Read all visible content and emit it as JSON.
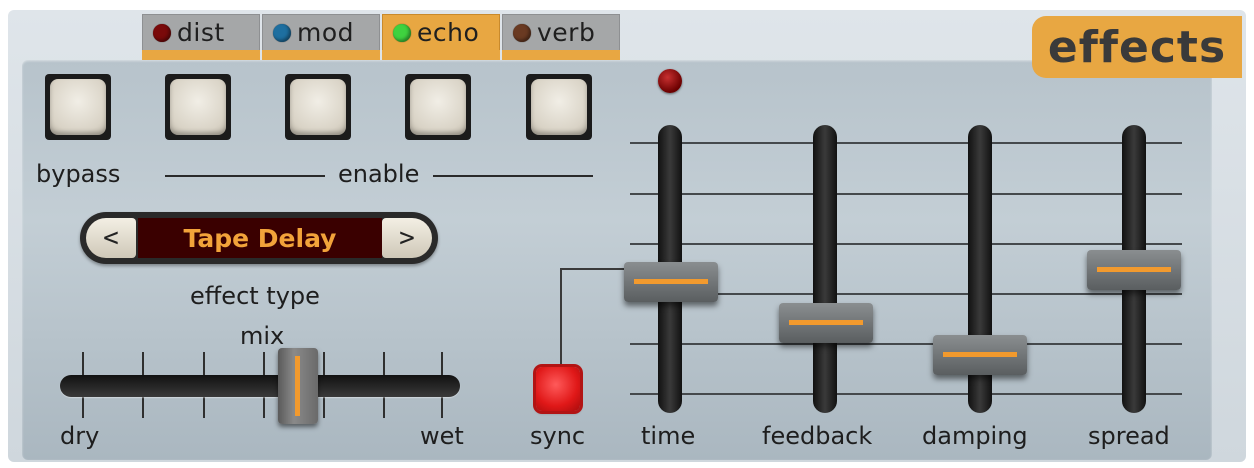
{
  "tabs": [
    {
      "label": "dist",
      "lamp_color": "#7a0a0a",
      "active": false
    },
    {
      "label": "mod",
      "lamp_color": "#1e6fa0",
      "active": false
    },
    {
      "label": "echo",
      "lamp_color": "#3fd23f",
      "active": true
    },
    {
      "label": "verb",
      "lamp_color": "#6a3a22",
      "active": false
    }
  ],
  "title": "effects",
  "buttons": {
    "bypass_label": "bypass",
    "enable_label": "enable"
  },
  "effect_selector": {
    "prev": "<",
    "next": ">",
    "value": "Tape Delay",
    "caption": "effect type"
  },
  "mix": {
    "label": "mix",
    "min_label": "dry",
    "max_label": "wet",
    "value_fraction": 0.6
  },
  "sync": {
    "label": "sync",
    "active": true
  },
  "faders": [
    {
      "label": "time",
      "value_fraction": 0.53
    },
    {
      "label": "feedback",
      "value_fraction": 0.35
    },
    {
      "label": "damping",
      "value_fraction": 0.23
    },
    {
      "label": "spread",
      "value_fraction": 0.58
    }
  ],
  "colors": {
    "accent": "#e8a742",
    "display_text": "#f2a33a",
    "sync_red": "#e01818"
  }
}
